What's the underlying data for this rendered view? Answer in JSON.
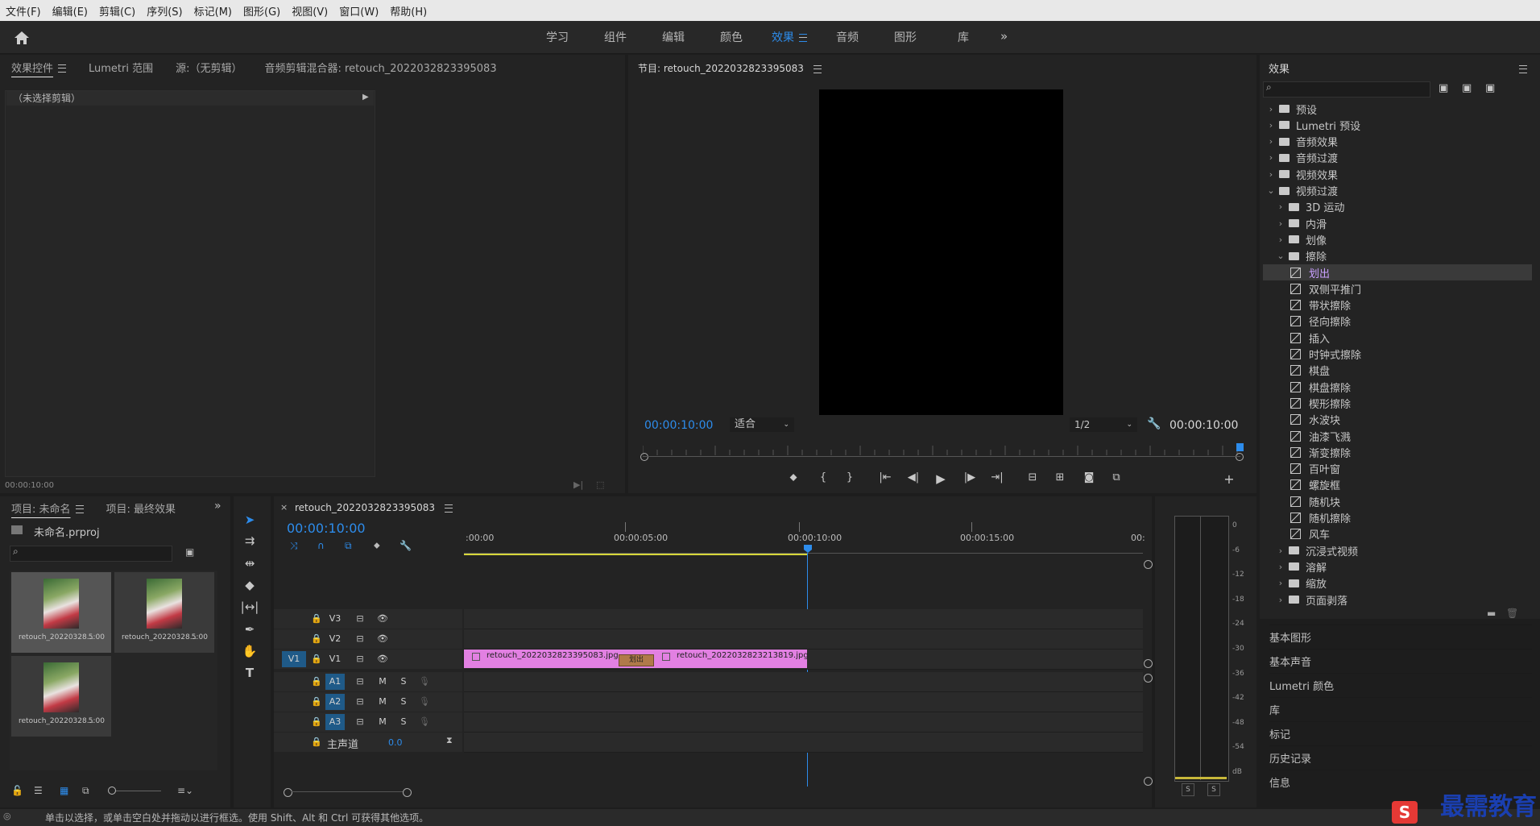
{
  "menu": [
    "文件(F)",
    "编辑(E)",
    "剪辑(C)",
    "序列(S)",
    "标记(M)",
    "图形(G)",
    "视图(V)",
    "窗口(W)",
    "帮助(H)"
  ],
  "workspaces": [
    "学习",
    "组件",
    "编辑",
    "颜色",
    "效果",
    "音频",
    "图形",
    "库"
  ],
  "active_workspace": "效果",
  "left_panel": {
    "tabs": [
      "效果控件",
      "Lumetri 范围",
      "源:（无剪辑）",
      "音频剪辑混合器: retouch_2022032823395083"
    ],
    "no_clip": "（未选择剪辑）",
    "timecode": "00:00:10:00"
  },
  "program": {
    "title": "节目: retouch_2022032823395083",
    "timecode_left": "00:00:10:00",
    "fit": "适合",
    "resolution": "1/2",
    "timecode_right": "00:00:10:00"
  },
  "effects": {
    "title": "效果",
    "tree": [
      {
        "label": "预设",
        "level": 0,
        "type": "folder",
        "open": false
      },
      {
        "label": "Lumetri 预设",
        "level": 0,
        "type": "folder",
        "open": false
      },
      {
        "label": "音频效果",
        "level": 0,
        "type": "folder",
        "open": false
      },
      {
        "label": "音频过渡",
        "level": 0,
        "type": "folder",
        "open": false
      },
      {
        "label": "视频效果",
        "level": 0,
        "type": "folder",
        "open": false
      },
      {
        "label": "视频过渡",
        "level": 0,
        "type": "folder",
        "open": true
      },
      {
        "label": "3D 运动",
        "level": 1,
        "type": "folder",
        "open": false
      },
      {
        "label": "内滑",
        "level": 1,
        "type": "folder",
        "open": false
      },
      {
        "label": "划像",
        "level": 1,
        "type": "folder",
        "open": false
      },
      {
        "label": "擦除",
        "level": 1,
        "type": "folder",
        "open": true
      },
      {
        "label": "划出",
        "level": 2,
        "type": "fx",
        "selected": true
      },
      {
        "label": "双侧平推门",
        "level": 2,
        "type": "fx"
      },
      {
        "label": "带状擦除",
        "level": 2,
        "type": "fx"
      },
      {
        "label": "径向擦除",
        "level": 2,
        "type": "fx"
      },
      {
        "label": "插入",
        "level": 2,
        "type": "fx"
      },
      {
        "label": "时钟式擦除",
        "level": 2,
        "type": "fx"
      },
      {
        "label": "棋盘",
        "level": 2,
        "type": "fx"
      },
      {
        "label": "棋盘擦除",
        "level": 2,
        "type": "fx"
      },
      {
        "label": "楔形擦除",
        "level": 2,
        "type": "fx"
      },
      {
        "label": "水波块",
        "level": 2,
        "type": "fx"
      },
      {
        "label": "油漆飞溅",
        "level": 2,
        "type": "fx"
      },
      {
        "label": "渐变擦除",
        "level": 2,
        "type": "fx"
      },
      {
        "label": "百叶窗",
        "level": 2,
        "type": "fx"
      },
      {
        "label": "螺旋框",
        "level": 2,
        "type": "fx"
      },
      {
        "label": "随机块",
        "level": 2,
        "type": "fx"
      },
      {
        "label": "随机擦除",
        "level": 2,
        "type": "fx"
      },
      {
        "label": "风车",
        "level": 2,
        "type": "fx"
      },
      {
        "label": "沉浸式视频",
        "level": 1,
        "type": "folder",
        "open": false
      },
      {
        "label": "溶解",
        "level": 1,
        "type": "folder",
        "open": false
      },
      {
        "label": "缩放",
        "level": 1,
        "type": "folder",
        "open": false
      },
      {
        "label": "页面剥落",
        "level": 1,
        "type": "folder",
        "open": false
      }
    ]
  },
  "side_panels": [
    "基本图形",
    "基本声音",
    "Lumetri 颜色",
    "库",
    "标记",
    "历史记录",
    "信息"
  ],
  "project": {
    "tabs": [
      "项目: 未命名",
      "项目: 最终效果"
    ],
    "file": "未命名.prproj",
    "items": [
      {
        "label": "retouch_20220328...",
        "dur": "5:00"
      },
      {
        "label": "retouch_20220328...",
        "dur": "5:00"
      },
      {
        "label": "retouch_20220328...",
        "dur": "5:00"
      }
    ]
  },
  "timeline": {
    "title": "retouch_2022032823395083",
    "timecode": "00:00:10:00",
    "ruler": [
      ":00:00",
      "00:00:05:00",
      "00:00:10:00",
      "00:00:15:00",
      "00:"
    ],
    "video_tracks": [
      "V3",
      "V2",
      "V1"
    ],
    "audio_tracks": [
      "A1",
      "A2",
      "A3"
    ],
    "source_patch": "V1",
    "master": {
      "label": "主声道",
      "value": "0.0"
    },
    "clips": [
      "retouch_2022032823395083.jpg",
      "retouch_2022032823213819.jpg"
    ],
    "transition": "划出",
    "ms": [
      "M",
      "S"
    ]
  },
  "vu": {
    "scale": [
      "0",
      "-6",
      "-12",
      "-18",
      "-24",
      "-30",
      "-36",
      "-42",
      "-48",
      "-54",
      "dB"
    ],
    "solo": [
      "S",
      "S"
    ]
  },
  "status": "单击以选择，或单击空白处并拖动以进行框选。使用 Shift、Alt 和 Ctrl 可获得其他选项。",
  "watermark": "最需教育"
}
